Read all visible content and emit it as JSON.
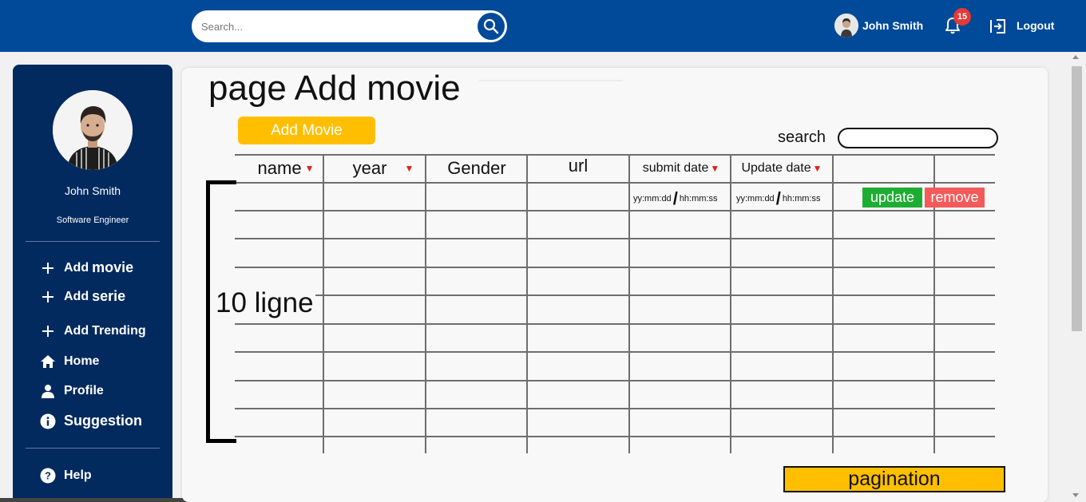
{
  "header": {
    "search_placeholder": "Search...",
    "username": "John Smith",
    "notification_count": "15",
    "logout_label": "Logout",
    "brand_color": "#004a99"
  },
  "sidebar": {
    "name": "John Smith",
    "role": "Software Engineer",
    "items": [
      {
        "prefix": "Add",
        "label": "movie",
        "icon": "plus-icon"
      },
      {
        "prefix": "Add",
        "label": "serie",
        "icon": "plus-icon"
      },
      {
        "prefix": "Add",
        "label": "Trending",
        "icon": "plus-icon"
      },
      {
        "prefix": "",
        "label": "Home",
        "icon": "home-icon"
      },
      {
        "prefix": "",
        "label": "Profile",
        "icon": "person-icon"
      },
      {
        "prefix": "",
        "label": "Suggestion",
        "icon": "info-icon"
      }
    ],
    "help_label": "Help",
    "color": "#022a5e"
  },
  "main": {
    "title": "page Add movie",
    "add_button": "Add Movie",
    "search_label": "search",
    "columns": [
      {
        "label": "name",
        "sortable": true
      },
      {
        "label": "year",
        "sortable": true
      },
      {
        "label": "Gender",
        "sortable": false
      },
      {
        "label": "url",
        "sortable": false
      },
      {
        "label": "submit date",
        "sortable": true
      },
      {
        "label": "Update date",
        "sortable": true
      },
      {
        "label": "",
        "sortable": false
      },
      {
        "label": "",
        "sortable": false
      }
    ],
    "row1": {
      "submit_date": "yy:mm:dd",
      "submit_time": "hh:mm:ss",
      "update_date": "yy:mm:dd",
      "update_time": "hh:mm:ss",
      "update_button": "update",
      "remove_button": "remove"
    },
    "rows_annotation": "10 ligne",
    "pagination_label": "pagination",
    "accent_yellow": "#ffbf00",
    "update_green": "#1ead33",
    "remove_red": "#f45a5a"
  }
}
